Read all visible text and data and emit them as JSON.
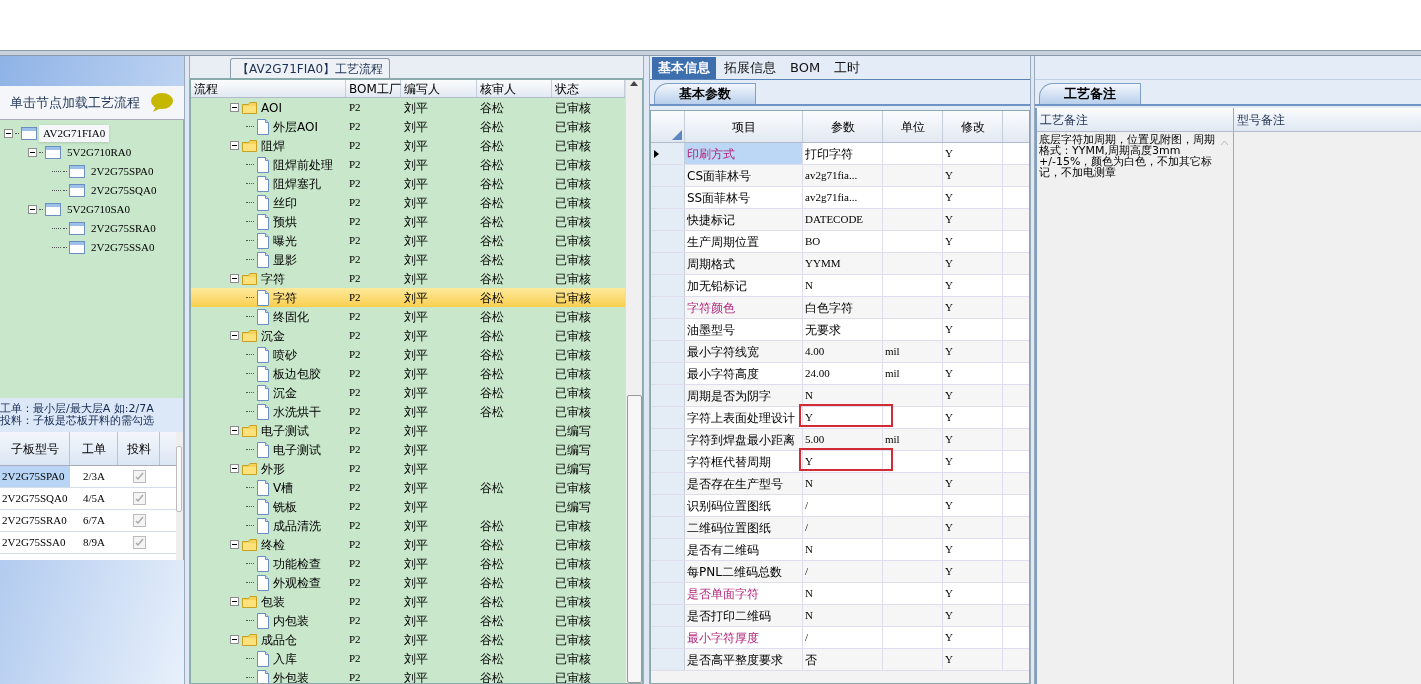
{
  "left_panel": {
    "hint": "单击节点加载工艺流程",
    "tree": [
      {
        "label": "AV2G71FIA0",
        "selected": true,
        "children": [
          {
            "label": "5V2G710RA0",
            "selected": false,
            "children": [
              {
                "label": "2V2G75SPA0",
                "selected": false
              },
              {
                "label": "2V2G75SQA0",
                "selected": false
              }
            ]
          },
          {
            "label": "5V2G710SA0",
            "selected": false,
            "children": [
              {
                "label": "2V2G75SRA0",
                "selected": false
              },
              {
                "label": "2V2G75SSA0",
                "selected": false
              }
            ]
          }
        ]
      }
    ],
    "note_lines": [
      "工单：最小层/最大层A 如:2/7A",
      "投料：子板是芯板开料的需勾选"
    ],
    "table": {
      "columns": [
        "子板型号",
        "工单",
        "投料"
      ],
      "rows": [
        {
          "model": "2V2G75SPA0",
          "order": "2/3A",
          "feed": true,
          "selected": true
        },
        {
          "model": "2V2G75SQA0",
          "order": "4/5A",
          "feed": true,
          "selected": false
        },
        {
          "model": "2V2G75SRA0",
          "order": "6/7A",
          "feed": true,
          "selected": false
        },
        {
          "model": "2V2G75SSA0",
          "order": "8/9A",
          "feed": true,
          "selected": false
        }
      ]
    }
  },
  "process_panel": {
    "title": "【AV2G71FIA0】工艺流程",
    "columns": [
      "流程",
      "BOM工厂",
      "编写人",
      "核审人",
      "状态"
    ],
    "tree": [
      {
        "name": "AOI",
        "bom": "P2",
        "writer": "刘平",
        "reviewer": "谷松",
        "status": "已审核",
        "selected": false,
        "children": [
          {
            "name": "外层AOI",
            "bom": "P2",
            "writer": "刘平",
            "reviewer": "谷松",
            "status": "已审核",
            "selected": false
          }
        ]
      },
      {
        "name": "阻焊",
        "bom": "P2",
        "writer": "刘平",
        "reviewer": "谷松",
        "status": "已审核",
        "selected": false,
        "children": [
          {
            "name": "阻焊前处理",
            "bom": "P2",
            "writer": "刘平",
            "reviewer": "谷松",
            "status": "已审核",
            "selected": false
          },
          {
            "name": "阻焊塞孔",
            "bom": "P2",
            "writer": "刘平",
            "reviewer": "谷松",
            "status": "已审核",
            "selected": false
          },
          {
            "name": "丝印",
            "bom": "P2",
            "writer": "刘平",
            "reviewer": "谷松",
            "status": "已审核",
            "selected": false
          },
          {
            "name": "预烘",
            "bom": "P2",
            "writer": "刘平",
            "reviewer": "谷松",
            "status": "已审核",
            "selected": false
          },
          {
            "name": "曝光",
            "bom": "P2",
            "writer": "刘平",
            "reviewer": "谷松",
            "status": "已审核",
            "selected": false
          },
          {
            "name": "显影",
            "bom": "P2",
            "writer": "刘平",
            "reviewer": "谷松",
            "status": "已审核",
            "selected": false
          }
        ]
      },
      {
        "name": "字符",
        "bom": "P2",
        "writer": "刘平",
        "reviewer": "谷松",
        "status": "已审核",
        "selected": false,
        "children": [
          {
            "name": "字符",
            "bom": "P2",
            "writer": "刘平",
            "reviewer": "谷松",
            "status": "已审核",
            "selected": true
          },
          {
            "name": "终固化",
            "bom": "P2",
            "writer": "刘平",
            "reviewer": "谷松",
            "status": "已审核",
            "selected": false
          }
        ]
      },
      {
        "name": "沉金",
        "bom": "P2",
        "writer": "刘平",
        "reviewer": "谷松",
        "status": "已审核",
        "selected": false,
        "children": [
          {
            "name": "喷砂",
            "bom": "P2",
            "writer": "刘平",
            "reviewer": "谷松",
            "status": "已审核",
            "selected": false
          },
          {
            "name": "板边包胶",
            "bom": "P2",
            "writer": "刘平",
            "reviewer": "谷松",
            "status": "已审核",
            "selected": false
          },
          {
            "name": "沉金",
            "bom": "P2",
            "writer": "刘平",
            "reviewer": "谷松",
            "status": "已审核",
            "selected": false
          },
          {
            "name": "水洗烘干",
            "bom": "P2",
            "writer": "刘平",
            "reviewer": "谷松",
            "status": "已审核",
            "selected": false
          }
        ]
      },
      {
        "name": "电子测试",
        "bom": "P2",
        "writer": "刘平",
        "status": "已编写",
        "selected": false,
        "children": [
          {
            "name": "电子测试",
            "bom": "P2",
            "writer": "刘平",
            "status": "已编写",
            "selected": false
          }
        ]
      },
      {
        "name": "外形",
        "bom": "P2",
        "writer": "刘平",
        "status": "已编写",
        "selected": false,
        "children": [
          {
            "name": "V槽",
            "bom": "P2",
            "writer": "刘平",
            "reviewer": "谷松",
            "status": "已审核",
            "selected": false
          },
          {
            "name": "铣板",
            "bom": "P2",
            "writer": "刘平",
            "status": "已编写",
            "selected": false
          },
          {
            "name": "成品清洗",
            "bom": "P2",
            "writer": "刘平",
            "reviewer": "谷松",
            "status": "已审核",
            "selected": false
          }
        ]
      },
      {
        "name": "终检",
        "bom": "P2",
        "writer": "刘平",
        "reviewer": "谷松",
        "status": "已审核",
        "selected": false,
        "children": [
          {
            "name": "功能检查",
            "bom": "P2",
            "writer": "刘平",
            "reviewer": "谷松",
            "status": "已审核",
            "selected": false
          },
          {
            "name": "外观检查",
            "bom": "P2",
            "writer": "刘平",
            "reviewer": "谷松",
            "status": "已审核",
            "selected": false
          }
        ]
      },
      {
        "name": "包装",
        "bom": "P2",
        "writer": "刘平",
        "reviewer": "谷松",
        "status": "已审核",
        "selected": false,
        "children": [
          {
            "name": "内包装",
            "bom": "P2",
            "writer": "刘平",
            "reviewer": "谷松",
            "status": "已审核",
            "selected": false
          }
        ]
      },
      {
        "name": "成品仓",
        "bom": "P2",
        "writer": "刘平",
        "reviewer": "谷松",
        "status": "已审核",
        "selected": false,
        "children": [
          {
            "name": "入库",
            "bom": "P2",
            "writer": "刘平",
            "reviewer": "谷松",
            "status": "已审核",
            "selected": false
          },
          {
            "name": "外包装",
            "bom": "P2",
            "writer": "刘平",
            "reviewer": "谷松",
            "status": "已审核",
            "selected": false
          }
        ]
      }
    ]
  },
  "info_panel": {
    "tabs": [
      {
        "label": "基本信息",
        "selected": true
      },
      {
        "label": "拓展信息",
        "selected": false
      },
      {
        "label": "BOM",
        "selected": false
      },
      {
        "label": "工时",
        "selected": false
      }
    ],
    "subtabs": [
      {
        "label": "基本参数",
        "selected": true
      }
    ],
    "columns": [
      "项目",
      "参数",
      "单位",
      "修改"
    ],
    "rows": [
      {
        "item": "印刷方式",
        "value": "打印字符",
        "edit": "Y",
        "selected": true,
        "emphasized": true,
        "highlighted": false
      },
      {
        "item": "CS面菲林号",
        "value": "av2g71fia...",
        "edit": "Y",
        "selected": false,
        "emphasized": false,
        "highlighted": false
      },
      {
        "item": "SS面菲林号",
        "value": "av2g71fia...",
        "edit": "Y",
        "selected": false,
        "emphasized": false,
        "highlighted": false
      },
      {
        "item": "快捷标记",
        "value": "DATECODE",
        "edit": "Y",
        "selected": false,
        "emphasized": false,
        "highlighted": false
      },
      {
        "item": "生产周期位置",
        "value": "BO",
        "edit": "Y",
        "selected": false,
        "emphasized": false,
        "highlighted": false
      },
      {
        "item": "周期格式",
        "value": "YYMM",
        "edit": "Y",
        "selected": false,
        "emphasized": false,
        "highlighted": false
      },
      {
        "item": "加无铅标记",
        "value": "N",
        "edit": "Y",
        "selected": false,
        "emphasized": false,
        "highlighted": false
      },
      {
        "item": "字符颜色",
        "value": "白色字符",
        "edit": "Y",
        "selected": false,
        "emphasized": true,
        "highlighted": false
      },
      {
        "item": "油墨型号",
        "value": "无要求",
        "edit": "Y",
        "selected": false,
        "emphasized": false,
        "highlighted": false
      },
      {
        "item": "最小字符线宽",
        "value": "4.00",
        "unit": "mil",
        "edit": "Y",
        "selected": false,
        "emphasized": false,
        "highlighted": false
      },
      {
        "item": "最小字符高度",
        "value": "24.00",
        "unit": "mil",
        "edit": "Y",
        "selected": false,
        "emphasized": false,
        "highlighted": false
      },
      {
        "item": "周期是否为阴字",
        "value": "N",
        "edit": "Y",
        "selected": false,
        "emphasized": false,
        "highlighted": false
      },
      {
        "item": "字符上表面处理设计",
        "value": "Y",
        "edit": "Y",
        "selected": false,
        "emphasized": false,
        "highlighted": true
      },
      {
        "item": "字符到焊盘最小距离",
        "value": "5.00",
        "unit": "mil",
        "edit": "Y",
        "selected": false,
        "emphasized": false,
        "highlighted": false
      },
      {
        "item": "字符框代替周期",
        "value": "Y",
        "edit": "Y",
        "selected": false,
        "emphasized": false,
        "highlighted": true
      },
      {
        "item": "是否存在生产型号",
        "value": "N",
        "edit": "Y",
        "selected": false,
        "emphasized": false,
        "highlighted": false
      },
      {
        "item": "识别码位置图纸",
        "value": "/",
        "edit": "Y",
        "selected": false,
        "emphasized": false,
        "highlighted": false
      },
      {
        "item": "二维码位置图纸",
        "value": "/",
        "edit": "Y",
        "selected": false,
        "emphasized": false,
        "highlighted": false
      },
      {
        "item": "是否有二维码",
        "value": "N",
        "edit": "Y",
        "selected": false,
        "emphasized": false,
        "highlighted": false
      },
      {
        "item": "每PNL二维码总数",
        "value": "/",
        "edit": "Y",
        "selected": false,
        "emphasized": false,
        "highlighted": false
      },
      {
        "item": "是否单面字符",
        "value": "N",
        "edit": "Y",
        "selected": false,
        "emphasized": true,
        "highlighted": false
      },
      {
        "item": "是否打印二维码",
        "value": "N",
        "edit": "Y",
        "selected": false,
        "emphasized": false,
        "highlighted": false
      },
      {
        "item": "最小字符厚度",
        "value": "/",
        "edit": "Y",
        "selected": false,
        "emphasized": true,
        "highlighted": false
      },
      {
        "item": "是否高平整度要求",
        "value": "否",
        "edit": "Y",
        "selected": false,
        "emphasized": false,
        "highlighted": false
      }
    ]
  },
  "notes_panel": {
    "subtabs": [
      {
        "label": "工艺备注",
        "selected": true
      }
    ],
    "columns": [
      "工艺备注",
      "型号备注"
    ],
    "process_note": "底层字符加周期，位置见附图，周期格式：YYMM,周期高度3mm +/-15%，颜色为白色，不加其它标记，不加电测章"
  }
}
